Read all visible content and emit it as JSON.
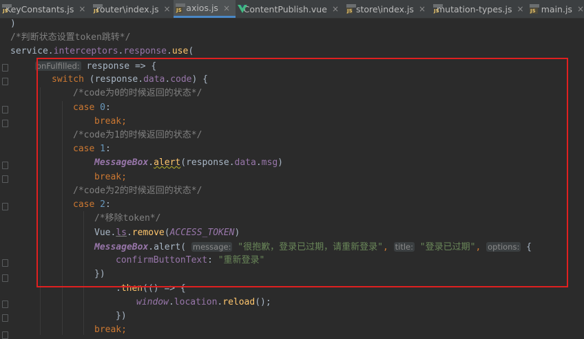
{
  "tabs": [
    {
      "label": "KeyConstants.js",
      "icon": "js-file-icon",
      "active": false
    },
    {
      "label": "router\\index.js",
      "icon": "js-file-icon",
      "active": false
    },
    {
      "label": "axios.js",
      "icon": "js-file-icon",
      "active": true
    },
    {
      "label": "ContentPublish.vue",
      "icon": "vue-file-icon",
      "active": false
    },
    {
      "label": "store\\index.js",
      "icon": "js-file-icon",
      "active": false
    },
    {
      "label": "mutation-types.js",
      "icon": "js-file-icon",
      "active": false
    },
    {
      "label": "main.js",
      "icon": "js-file-icon",
      "active": false
    }
  ],
  "close_glyph": "×",
  "code": {
    "l0": ")",
    "l1": "/*判断状态设置token跳转*/",
    "l2": {
      "a": "service",
      "b": ".",
      "c": "interceptors",
      "d": ".",
      "e": "response",
      "f": ".",
      "g": "use",
      "h": "("
    },
    "l3": {
      "hint": "onFulfilled:",
      "rest": " response => {"
    },
    "l4": {
      "kw": "switch",
      "a": " (response.",
      "b": "data",
      "c": ".",
      "d": "code",
      "e": ") {"
    },
    "l5": "/*code为0的时候返回的状态*/",
    "l6": {
      "kw": "case",
      "num": "0",
      "rest": ":"
    },
    "l7": {
      "kw": "break",
      "rest": ";"
    },
    "l8": "/*code为1的时候返回的状态*/",
    "l9": {
      "kw": "case",
      "num": "1",
      "rest": ":"
    },
    "l10": {
      "cls": "MessageBox",
      "a": ".",
      "fn": "alert",
      "b": "(response.",
      "c": "data",
      "d": ".",
      "e": "msg",
      "f": ")"
    },
    "l11": {
      "kw": "break",
      "rest": ";"
    },
    "l12": "/*code为2的时候返回的状态*/",
    "l13": {
      "kw": "case",
      "num": "2",
      "rest": ":"
    },
    "l14": "/*移除token*/",
    "l15": {
      "a": "Vue.",
      "b": "ls",
      "c": ".",
      "fn": "remove",
      "d": "(",
      "const": "ACCESS_TOKEN",
      "e": ")"
    },
    "l16": {
      "cls": "MessageBox",
      "a": ".alert(",
      "h1": "message:",
      "s1": "\"很抱歉，登录已过期，请重新登录\"",
      "c1": ",",
      "h2": "title:",
      "s2": "\"登录已过期\"",
      "c2": ",",
      "h3": "options:",
      "e": " {"
    },
    "l17": {
      "a": "confirmButtonText",
      "b": ": ",
      "s": "\"重新登录\""
    },
    "l18": "})",
    "l19": {
      "a": ".",
      "fn": "then",
      "b": "(() => {"
    },
    "l20": {
      "glob": "window",
      "a": ".",
      "b": "location",
      "c": ".",
      "fn": "reload",
      "d": "();"
    },
    "l21": "})",
    "l22": {
      "kw": "break",
      "rest": ";"
    }
  }
}
